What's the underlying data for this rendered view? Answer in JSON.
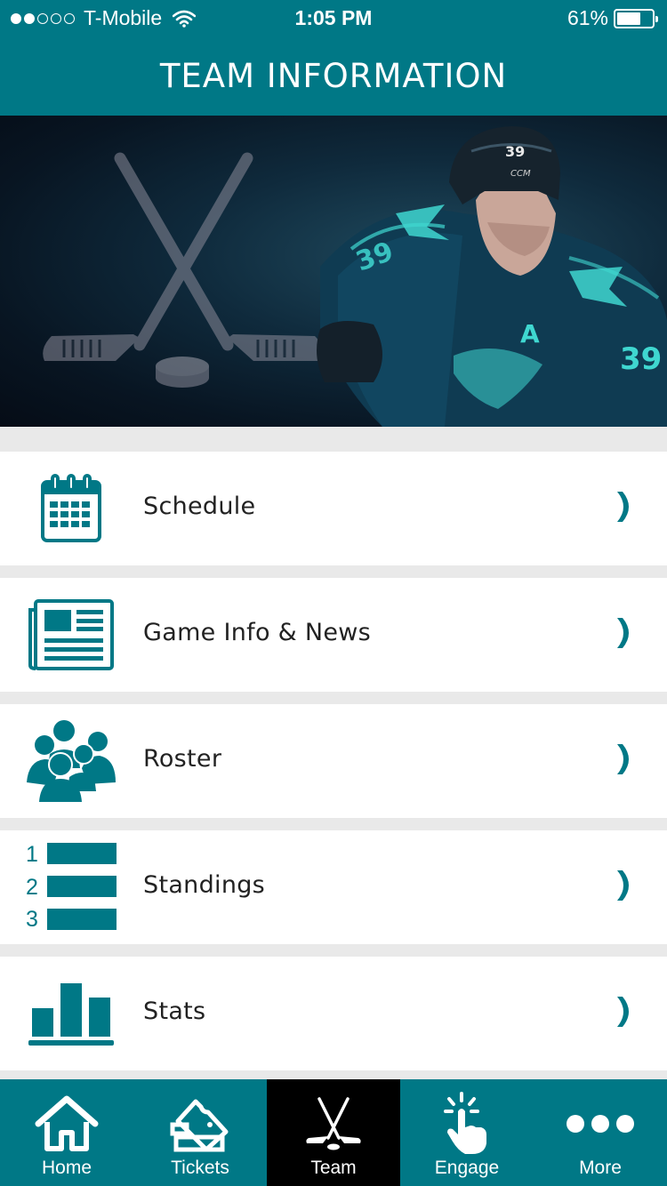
{
  "status_bar": {
    "carrier": "T-Mobile",
    "time": "1:05 PM",
    "battery": "61%"
  },
  "header": {
    "title": "TEAM INFORMATION"
  },
  "menu": [
    {
      "label": "Schedule",
      "icon": "calendar-icon"
    },
    {
      "label": "Game Info & News",
      "icon": "newspaper-icon"
    },
    {
      "label": "Roster",
      "icon": "people-group-icon"
    },
    {
      "label": "Standings",
      "icon": "standings-list-icon",
      "ranks": [
        "1",
        "2",
        "3"
      ]
    },
    {
      "label": "Stats",
      "icon": "bar-chart-icon"
    }
  ],
  "tabs": [
    {
      "label": "Home",
      "icon": "home-icon"
    },
    {
      "label": "Tickets",
      "icon": "ticket-icon"
    },
    {
      "label": "Team",
      "icon": "hockey-sticks-icon",
      "active": true
    },
    {
      "label": "Engage",
      "icon": "tap-icon"
    },
    {
      "label": "More",
      "icon": "more-dots-icon"
    }
  ],
  "hero": {
    "jersey_number": "39",
    "captain_letter": "A",
    "helmet_brand": "CCM"
  },
  "colors": {
    "brand": "#007886",
    "active_tab": "#000000",
    "text": "#222222",
    "chevron": "#007886"
  }
}
